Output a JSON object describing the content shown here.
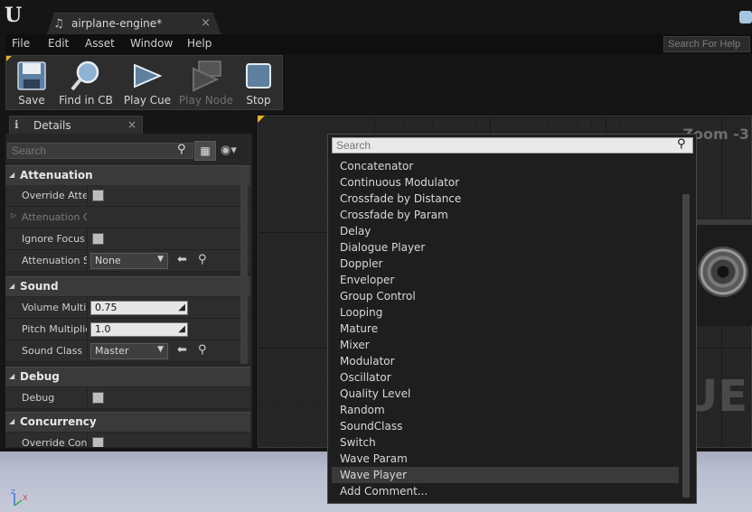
{
  "titlebar": {
    "tab_label": "airplane-engine*",
    "tab_close": "×"
  },
  "menubar": {
    "items": [
      "File",
      "Edit",
      "Asset",
      "Window",
      "Help"
    ],
    "search_placeholder": "Search For Help"
  },
  "toolbar": {
    "buttons": [
      {
        "label": "Save",
        "icon": "save-icon",
        "enabled": true
      },
      {
        "label": "Find in CB",
        "icon": "magnifier-icon",
        "enabled": true
      },
      {
        "label": "Play Cue",
        "icon": "play-icon",
        "enabled": true
      },
      {
        "label": "Play Node",
        "icon": "play-node-icon",
        "enabled": false
      },
      {
        "label": "Stop",
        "icon": "stop-icon",
        "enabled": true
      }
    ]
  },
  "details": {
    "tab_label": "Details",
    "tab_close": "×",
    "search_placeholder": "Search",
    "categories": {
      "attenuation": {
        "title": "Attenuation",
        "override": "Override Attenuation",
        "attenuation_overrides": "Attenuation Overrides",
        "ignore_focus": "Ignore Focus",
        "attenuation_settings": "Attenuation Settings",
        "attenuation_settings_value": "None"
      },
      "sound": {
        "title": "Sound",
        "volume_label": "Volume Multiplier",
        "volume_value": "0.75",
        "pitch_label": "Pitch Multiplier",
        "pitch_value": "1.0",
        "sound_class_label": "Sound Class",
        "sound_class_value": "Master"
      },
      "debug": {
        "title": "Debug",
        "debug_label": "Debug"
      },
      "concurrency": {
        "title": "Concurrency",
        "override_label": "Override Concurrency"
      }
    }
  },
  "graph": {
    "zoom_label": "Zoom -3",
    "watermark": "UE"
  },
  "context_menu": {
    "search_placeholder": "Search",
    "items": [
      "Concatenator",
      "Continuous Modulator",
      "Crossfade by Distance",
      "Crossfade by Param",
      "Delay",
      "Dialogue Player",
      "Doppler",
      "Enveloper",
      "Group Control",
      "Looping",
      "Mature",
      "Mixer",
      "Modulator",
      "Oscillator",
      "Quality Level",
      "Random",
      "SoundClass",
      "Switch",
      "Wave Param",
      "Wave Player",
      "Add Comment..."
    ],
    "selected_item": "Wave Player"
  },
  "colors": {
    "accent_corner": "#e6b125",
    "window_bg": "#151515",
    "panel_bg": "#262626",
    "menu_selected": "#3a3a3a"
  }
}
